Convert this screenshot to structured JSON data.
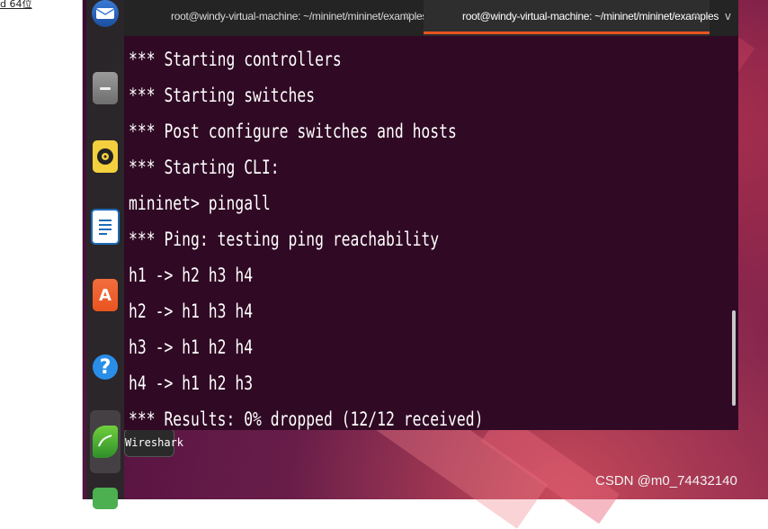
{
  "host": {
    "corner_text": "d 64位"
  },
  "terminal": {
    "tabs": [
      {
        "label": "root@windy-virtual-machine: ~/mininet/mininet/examples",
        "close": "X",
        "active": false
      },
      {
        "label": "root@windy-virtual-machine: ~/mininet/mininet/examples",
        "close": "X",
        "active": true
      }
    ],
    "dropdown": "v",
    "lines": [
      "*** Starting controllers",
      "*** Starting switches",
      "*** Post configure switches and hosts",
      "*** Starting CLI:",
      "mininet> pingall",
      "*** Ping: testing ping reachability",
      "h1 -> h2 h3 h4",
      "h2 -> h1 h3 h4",
      "h3 -> h1 h2 h4",
      "h4 -> h1 h2 h3",
      "*** Results: 0% dropped (12/12 received)"
    ],
    "colors": {
      "background": "#300a24",
      "text": "#ffffff",
      "accent": "#e95420"
    }
  },
  "dock": {
    "items": [
      {
        "name": "thunderbird-icon",
        "glyph": "✉"
      },
      {
        "name": "files-icon",
        "glyph": ""
      },
      {
        "name": "rhythmbox-icon",
        "glyph": ""
      },
      {
        "name": "writer-icon",
        "glyph": ""
      },
      {
        "name": "software-icon",
        "glyph": "A"
      },
      {
        "name": "help-icon",
        "glyph": "?"
      },
      {
        "name": "wireshark-icon",
        "glyph": ""
      }
    ],
    "tooltip": "Wireshark"
  },
  "watermark": "CSDN @m0_74432140"
}
